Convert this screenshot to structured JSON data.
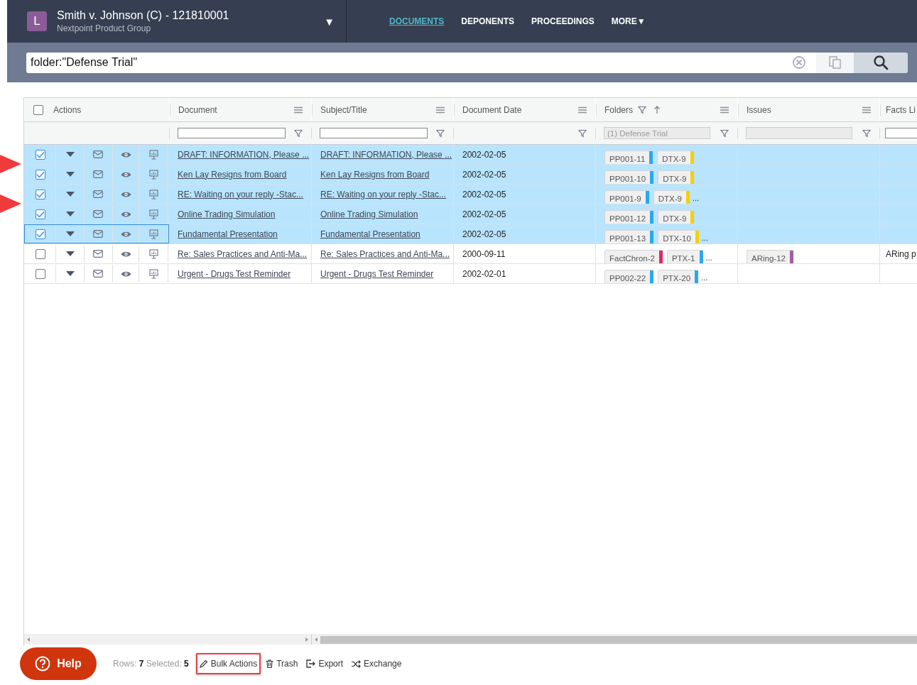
{
  "header": {
    "avatar": "L",
    "title": "Smith v. Johnson (C) - 121810001",
    "subtitle": "Nextpoint Product Group",
    "dropdown": "▼"
  },
  "nav": [
    {
      "label": "DOCUMENTS",
      "selected": true
    },
    {
      "label": "DEPONENTS",
      "selected": false
    },
    {
      "label": "PROCEEDINGS",
      "selected": false
    },
    {
      "label": "MORE",
      "caret": "▼",
      "selected": false
    }
  ],
  "search": {
    "value": "folder:\"Defense Trial\""
  },
  "table": {
    "select_all_checked": false,
    "columns": [
      {
        "label": "Actions",
        "kind": "actions"
      },
      {
        "label": "Document",
        "kind": "text_filter"
      },
      {
        "label": "Subject/Title",
        "kind": "text_filter"
      },
      {
        "label": "Document Date",
        "kind": "no_filter"
      },
      {
        "label": "Folders",
        "kind": "disabled_filter",
        "filter_value": "(1) Defense Trial",
        "filtered": true,
        "sort_ascending": true
      },
      {
        "label": "Issues",
        "kind": "disabled_filter"
      },
      {
        "label": "Facts Li",
        "kind": "text_filter"
      }
    ],
    "rows": [
      {
        "selected": true,
        "checked": true,
        "focused": false,
        "arrow_below": true,
        "document": "DRAFT: INFORMATION, Please ...",
        "subject": "DRAFT: INFORMATION, Please ...",
        "date": "2002-02-05",
        "folders": [
          {
            "label": "PP001-11",
            "color": "#2aa8f2"
          },
          {
            "label": "DTX-9",
            "color": "#f7cf00"
          }
        ]
      },
      {
        "selected": true,
        "checked": true,
        "focused": false,
        "arrow_below": false,
        "document": "Ken Lay Resigns from Board",
        "subject": "Ken Lay Resigns from Board",
        "date": "2002-02-05",
        "folders": [
          {
            "label": "PP001-10",
            "color": "#2aa8f2"
          },
          {
            "label": "DTX-9",
            "color": "#f7cf00"
          }
        ]
      },
      {
        "selected": true,
        "checked": true,
        "focused": false,
        "arrow_below": true,
        "document": "RE: Waiting on your reply -Stac...",
        "subject": "RE: Waiting on your reply -Stac...",
        "date": "2002-02-05",
        "folders": [
          {
            "label": "PP001-9",
            "color": "#2aa8f2"
          },
          {
            "label": "DTX-9",
            "color": "#f7cf00"
          }
        ],
        "folders_more": "..."
      },
      {
        "selected": true,
        "checked": true,
        "focused": false,
        "arrow_below": false,
        "document": "Online Trading Simulation",
        "subject": "Online Trading Simulation",
        "date": "2002-02-05",
        "folders": [
          {
            "label": "PP001-12",
            "color": "#2aa8f2"
          },
          {
            "label": "DTX-9",
            "color": "#f7cf00"
          }
        ]
      },
      {
        "selected": true,
        "checked": true,
        "focused": true,
        "arrow_below": false,
        "document": "Fundamental Presentation",
        "subject": "Fundamental Presentation",
        "date": "2002-02-05",
        "folders": [
          {
            "label": "PP001-13",
            "color": "#2aa8f2"
          },
          {
            "label": "DTX-10",
            "color": "#f7cf00"
          }
        ],
        "folders_more": "..."
      },
      {
        "selected": false,
        "checked": false,
        "focused": false,
        "arrow_below": false,
        "document": "Re: Sales Practices and Anti-Ma...",
        "subject": "Re: Sales Practices and Anti-Ma...",
        "date": "2000-09-11",
        "folders": [
          {
            "label": "FactChron-2",
            "color": "#e8265e"
          },
          {
            "label": "PTX-1",
            "color": "#2aa8f2"
          }
        ],
        "folders_more": "...",
        "issues": [
          {
            "label": "ARing-12",
            "color": "#a25ea8"
          }
        ],
        "facts": "ARing p"
      },
      {
        "selected": false,
        "checked": false,
        "focused": false,
        "arrow_below": false,
        "document": "Urgent - Drugs Test Reminder",
        "subject": "Urgent - Drugs Test Reminder",
        "date": "2002-02-01",
        "folders": [
          {
            "label": "PP002-22",
            "color": "#2aa8f2"
          },
          {
            "label": "PTX-20",
            "color": "#2aa8f2"
          }
        ],
        "folders_more": "..."
      }
    ]
  },
  "footer": {
    "help": "Help",
    "rows_label": "Rows:",
    "rows": "7",
    "selected_label": "Selected:",
    "selected": "5",
    "actions": [
      {
        "label": "Bulk Actions",
        "kind": "edit",
        "highlighted": true
      },
      {
        "label": "Trash",
        "kind": "trash",
        "highlighted": false
      },
      {
        "label": "Export",
        "kind": "export",
        "highlighted": false
      },
      {
        "label": "Exchange",
        "kind": "shuffle",
        "highlighted": false
      }
    ]
  }
}
